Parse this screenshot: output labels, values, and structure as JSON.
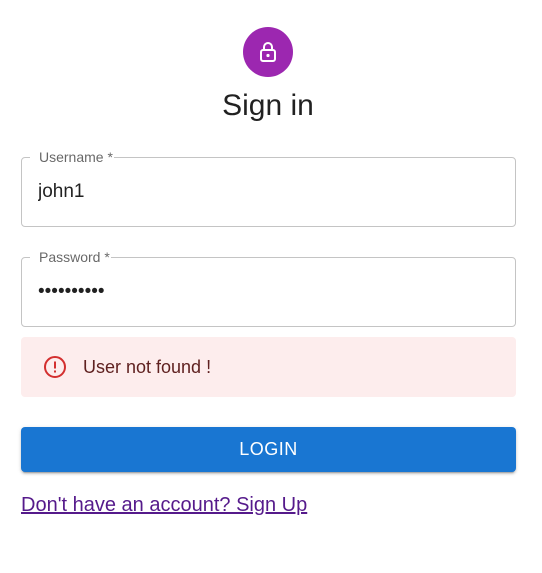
{
  "header": {
    "title": "Sign in",
    "icon": "lock-open-icon",
    "avatar_color": "#9c27b0"
  },
  "form": {
    "username": {
      "label": "Username *",
      "value": "john1"
    },
    "password": {
      "label": "Password *",
      "value": "••••••••••"
    }
  },
  "alert": {
    "severity": "error",
    "icon": "error-outline-icon",
    "message": "User not found !",
    "background": "#fdeded",
    "icon_color": "#d32f2f"
  },
  "actions": {
    "login_label": "LOGIN",
    "login_color": "#1976d2",
    "signup_link": "Don't have an account? Sign Up"
  }
}
